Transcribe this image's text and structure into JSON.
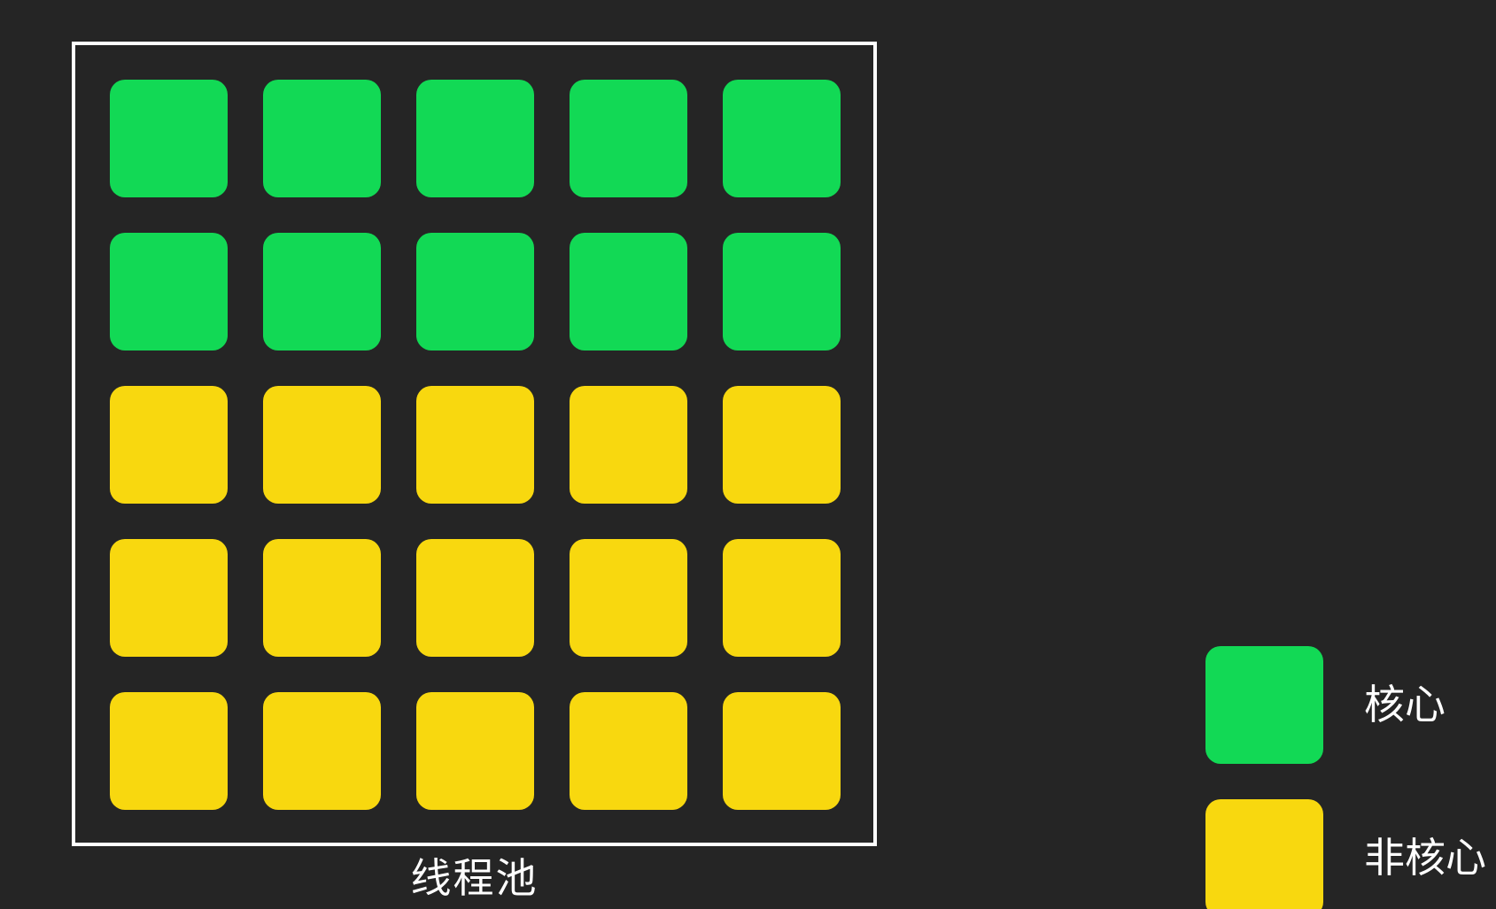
{
  "diagram": {
    "title": "线程池",
    "grid": {
      "rows": 5,
      "cols": 5,
      "row_types": [
        "core",
        "core",
        "non_core",
        "non_core",
        "non_core"
      ]
    },
    "legend": [
      {
        "key": "core",
        "label": "核心",
        "color": "#12d955"
      },
      {
        "key": "non_core",
        "label": "非核心",
        "color": "#f8d80f"
      }
    ],
    "colors": {
      "background": "#252525",
      "frame": "#ffffff",
      "core": "#12d955",
      "non_core": "#f8d80f"
    }
  }
}
